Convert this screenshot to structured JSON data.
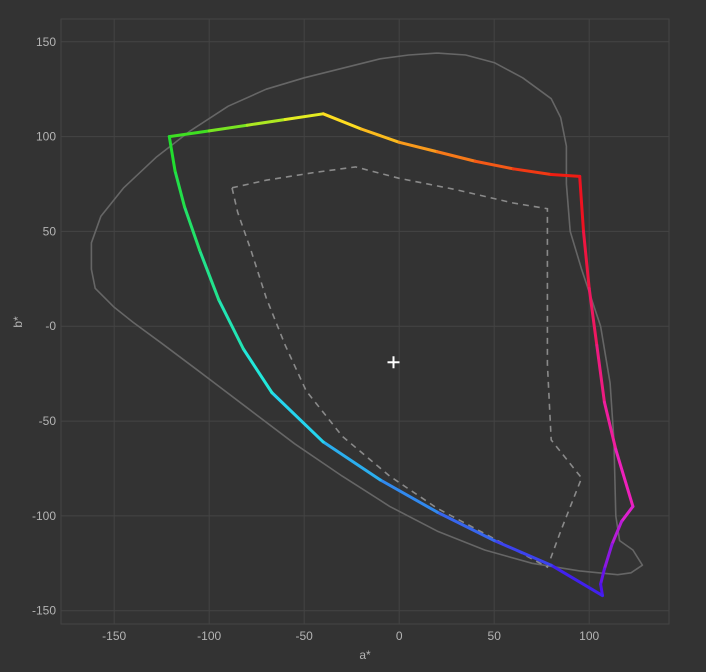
{
  "chart_data": {
    "type": "line",
    "title": "",
    "xlabel": "a*",
    "ylabel": "b*",
    "xlim": [
      -178,
      142
    ],
    "ylim": [
      -157,
      162
    ],
    "x_ticks": [
      -150,
      -100,
      -50,
      0,
      50,
      100
    ],
    "y_ticks": [
      150,
      100,
      50,
      0,
      -50,
      -100,
      -150
    ],
    "x_tick_labels": [
      "-150",
      "-100",
      "-50",
      "0",
      "50",
      "100"
    ],
    "y_tick_labels": [
      "150",
      "100",
      "50",
      "-0",
      "-50",
      "-100",
      "-150"
    ],
    "grid": true,
    "legend": "none",
    "colors": {
      "background": "#333333",
      "grid": "#444444",
      "outline": "#666666",
      "dashed": "#8a8a8a",
      "white_point": "#ffffff"
    },
    "series": [
      {
        "style": "gradient-solid",
        "corners": [
          {
            "x": -121,
            "y": 100,
            "color": "#22dd22"
          },
          {
            "x": -40,
            "y": 112,
            "color": "#ffee22"
          },
          {
            "x": 95,
            "y": 79,
            "color": "#ee1111"
          },
          {
            "x": 123,
            "y": -95,
            "color": "#ee22cc"
          },
          {
            "x": 107,
            "y": -142,
            "color": "#4411ee"
          },
          {
            "x": -67,
            "y": -35,
            "color": "#22e8ee"
          }
        ],
        "points": [
          [
            -121,
            100
          ],
          [
            -100,
            103
          ],
          [
            -80,
            106
          ],
          [
            -60,
            109
          ],
          [
            -40,
            112
          ],
          [
            -20,
            104
          ],
          [
            0,
            97
          ],
          [
            20,
            92
          ],
          [
            40,
            87
          ],
          [
            60,
            83
          ],
          [
            80,
            80
          ],
          [
            95,
            79
          ],
          [
            97,
            50
          ],
          [
            100,
            20
          ],
          [
            104,
            -10
          ],
          [
            108,
            -40
          ],
          [
            114,
            -65
          ],
          [
            123,
            -95
          ],
          [
            117,
            -103
          ],
          [
            112,
            -115
          ],
          [
            108,
            -128
          ],
          [
            106,
            -136
          ],
          [
            107,
            -142
          ],
          [
            80,
            -126
          ],
          [
            50,
            -113
          ],
          [
            20,
            -98
          ],
          [
            -10,
            -81
          ],
          [
            -40,
            -61
          ],
          [
            -67,
            -35
          ],
          [
            -82,
            -12
          ],
          [
            -95,
            14
          ],
          [
            -105,
            40
          ],
          [
            -113,
            63
          ],
          [
            -118,
            82
          ],
          [
            -121,
            100
          ]
        ]
      },
      {
        "style": "dashed",
        "points": [
          [
            -88,
            73
          ],
          [
            -70,
            77
          ],
          [
            -45,
            81
          ],
          [
            -23,
            84
          ],
          [
            0,
            78
          ],
          [
            30,
            72
          ],
          [
            60,
            65
          ],
          [
            78,
            62
          ],
          [
            78,
            20
          ],
          [
            78,
            -20
          ],
          [
            80,
            -60
          ],
          [
            96,
            -80
          ],
          [
            85,
            -108
          ],
          [
            78,
            -127
          ],
          [
            50,
            -112
          ],
          [
            20,
            -96
          ],
          [
            -5,
            -79
          ],
          [
            -30,
            -58
          ],
          [
            -49,
            -34
          ],
          [
            -60,
            -10
          ],
          [
            -70,
            15
          ],
          [
            -78,
            40
          ],
          [
            -85,
            60
          ],
          [
            -88,
            73
          ]
        ]
      },
      {
        "style": "solid-thin",
        "points": [
          [
            20,
            144
          ],
          [
            5,
            143
          ],
          [
            -10,
            141
          ],
          [
            -30,
            136
          ],
          [
            -50,
            131
          ],
          [
            -70,
            125
          ],
          [
            -90,
            116
          ],
          [
            -110,
            103
          ],
          [
            -128,
            89
          ],
          [
            -145,
            73
          ],
          [
            -157,
            58
          ],
          [
            -162,
            44
          ],
          [
            -162,
            30
          ],
          [
            -160,
            20
          ],
          [
            -150,
            10
          ],
          [
            -140,
            2
          ],
          [
            -125,
            -9
          ],
          [
            -105,
            -24
          ],
          [
            -80,
            -43
          ],
          [
            -55,
            -62
          ],
          [
            -30,
            -79
          ],
          [
            -5,
            -95
          ],
          [
            20,
            -108
          ],
          [
            45,
            -118
          ],
          [
            70,
            -125
          ],
          [
            95,
            -129
          ],
          [
            115,
            -131
          ],
          [
            122,
            -130
          ],
          [
            128,
            -126
          ],
          [
            123,
            -118
          ],
          [
            116,
            -113
          ],
          [
            114,
            -100
          ],
          [
            113,
            -60
          ],
          [
            111,
            -30
          ],
          [
            106,
            0
          ],
          [
            96,
            30
          ],
          [
            90,
            50
          ],
          [
            88,
            75
          ],
          [
            88,
            95
          ],
          [
            85,
            110
          ],
          [
            80,
            120
          ],
          [
            65,
            131
          ],
          [
            50,
            139
          ],
          [
            35,
            143
          ],
          [
            20,
            144
          ]
        ]
      }
    ],
    "white_point": {
      "x": -3,
      "y": -19
    }
  }
}
